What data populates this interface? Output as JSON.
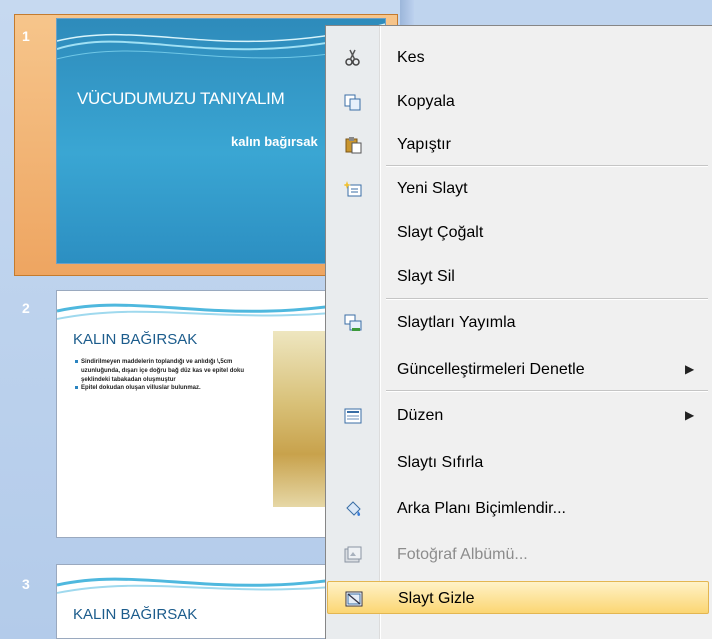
{
  "slides": [
    {
      "number": "1",
      "title": "VÜCUDUMUZU TANIYALIM",
      "subtitle": "kalın bağırsak"
    },
    {
      "number": "2",
      "title": "KALIN BAĞIRSAK",
      "bullets": [
        "Sindirilmeyen maddelerin toplandığı ve anlıdığı \\,5cm uzunluğunda, dışarı içe doğru bağ düz kas ve epitel doku şeklindeki tabakadan oluşmuştur",
        "Epitel dokudan oluşan villuslar bulunmaz."
      ]
    },
    {
      "number": "3",
      "title": "KALIN BAĞIRSAK"
    }
  ],
  "menu": {
    "items": [
      {
        "label": "Kes",
        "icon": "scissors-icon"
      },
      {
        "label": "Kopyala",
        "icon": "copy-icon"
      },
      {
        "label": "Yapıştır",
        "icon": "paste-icon"
      },
      {
        "label": "Yeni Slayt",
        "icon": "new-slide-icon"
      },
      {
        "label": "Slayt Çoğalt"
      },
      {
        "label": "Slayt Sil"
      },
      {
        "label": "Slaytları Yayımla",
        "icon": "publish-slides-icon"
      },
      {
        "label": "Güncelleştirmeleri Denetle",
        "submenu": "▶"
      },
      {
        "label": "Düzen",
        "icon": "layout-icon",
        "submenu": "▶"
      },
      {
        "label": "Slaytı Sıfırla"
      },
      {
        "label": "Arka Planı Biçimlendir...",
        "icon": "format-background-icon"
      },
      {
        "label": "Fotoğraf Albümü...",
        "icon": "photo-album-icon",
        "disabled": true
      },
      {
        "label": "Slayt Gizle",
        "icon": "hide-slide-icon",
        "highlighted": true
      }
    ]
  },
  "colors": {
    "selection": "#f2b36f",
    "menu_hover": "#fbd673",
    "slide_blue": "#3aa6d3"
  }
}
